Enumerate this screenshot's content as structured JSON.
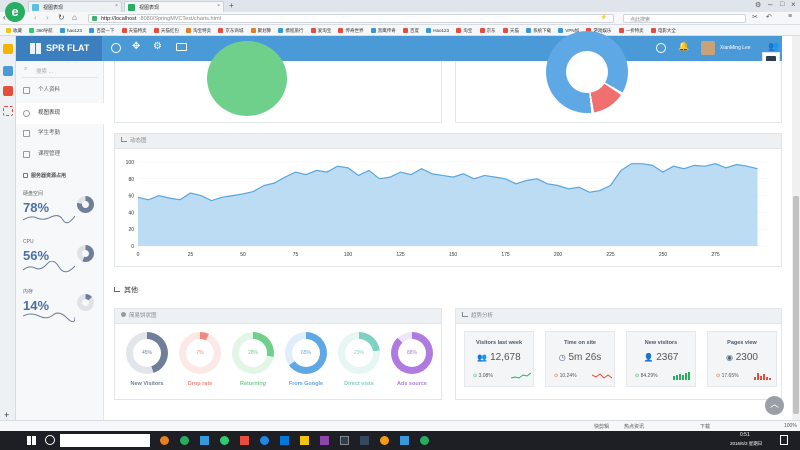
{
  "browser": {
    "tabs": [
      {
        "label": "视图表现"
      },
      {
        "label": "视图表现"
      }
    ],
    "url_host": "http://localhost",
    "url_rest": ":8080/SpringMVCTest/charts.html",
    "search_placeholder": "点此搜索",
    "bookmarks": [
      "收藏",
      "360导航",
      "hao123",
      "百度一下",
      "天猫特卖",
      "天猫红包",
      "淘宝特卖",
      "京东商城",
      "聚划算",
      "携程旅行",
      "爱淘宝",
      "传奇世界",
      "黑鹰传奇",
      "百度",
      "Hao123",
      "淘宝",
      "京东",
      "天猫",
      "系统下载",
      "VPN加",
      "游戏娱乐",
      "一折特卖",
      "电影大全"
    ],
    "status": [
      "快剪辑",
      "热点资讯",
      "下载",
      "100%"
    ]
  },
  "app": {
    "logo_a": "SPR",
    "logo_b": "FLAT",
    "user_name": "XianMing Lee",
    "search_placeholder": "搜索 ...",
    "menu": [
      "个人资料",
      "视图表现",
      "学生考勤",
      "课程管理"
    ],
    "usage_title": "服务器资源占用",
    "stats": [
      {
        "label": "硬盘空间",
        "value": "78%"
      },
      {
        "label": "CPU",
        "value": "56%"
      },
      {
        "label": "内存",
        "value": "14%"
      }
    ],
    "area_title": "动态图",
    "section_title": "其他",
    "pie_title": "简易饼状图",
    "trend_title": "趋势分析",
    "donuts": [
      {
        "pct": "45%",
        "label": "New Visitors",
        "color": "#6f7f99",
        "value": 45
      },
      {
        "pct": "7%",
        "label": "Drop rate",
        "color": "#f08a7e",
        "value": 7
      },
      {
        "pct": "28%",
        "label": "Returning",
        "color": "#6fd08c",
        "value": 28
      },
      {
        "pct": "65%",
        "label": "From Google",
        "color": "#5fa8e6",
        "value": 65
      },
      {
        "pct": "23%",
        "label": "Direct vists",
        "color": "#7fd1c2",
        "value": 23
      },
      {
        "pct": "88%",
        "label": "Ads source",
        "color": "#b07be0",
        "value": 88
      }
    ],
    "cards": [
      {
        "title": "Visitors last week",
        "value": "12,678",
        "pct": "3.08%",
        "up": true
      },
      {
        "title": "Time on site",
        "value": "5m 26s",
        "pct": "10.24%",
        "up": false
      },
      {
        "title": "New visitors",
        "value": "2367",
        "pct": "84.29%",
        "up": true
      },
      {
        "title": "Pages view",
        "value": "2300",
        "pct": "17.65%",
        "up": false
      }
    ]
  },
  "taskbar": {
    "time": "0:51",
    "date": "2016/6/3 星期日"
  },
  "chart_data": {
    "type": "area",
    "title": "",
    "xlabel": "",
    "ylabel": "",
    "xlim": [
      0,
      300
    ],
    "ylim": [
      0,
      100
    ],
    "x_ticks": [
      0,
      25,
      50,
      75,
      100,
      125,
      150,
      175,
      200,
      225,
      250,
      275
    ],
    "y_ticks": [
      0,
      20,
      40,
      60,
      80,
      100
    ],
    "series": [
      {
        "color": "#5aa5dd",
        "x": [
          0,
          5,
          10,
          15,
          20,
          25,
          30,
          35,
          40,
          45,
          50,
          55,
          60,
          65,
          70,
          75,
          80,
          85,
          90,
          95,
          100,
          105,
          110,
          115,
          120,
          125,
          130,
          135,
          140,
          145,
          150,
          155,
          160,
          165,
          170,
          175,
          180,
          185,
          190,
          195,
          200,
          205,
          210,
          215,
          220,
          225,
          230,
          235,
          240,
          245,
          250,
          255,
          260,
          265,
          270,
          275,
          280,
          285,
          290,
          295
        ],
        "values": [
          58,
          55,
          60,
          57,
          55,
          63,
          60,
          54,
          58,
          60,
          62,
          65,
          72,
          75,
          82,
          88,
          85,
          90,
          88,
          95,
          93,
          84,
          90,
          80,
          82,
          88,
          85,
          92,
          86,
          84,
          82,
          86,
          80,
          84,
          82,
          80,
          74,
          78,
          80,
          74,
          72,
          68,
          70,
          64,
          66,
          72,
          90,
          98,
          98,
          96,
          88,
          95,
          92,
          96,
          95,
          98,
          93,
          97,
          95,
          92
        ]
      }
    ]
  }
}
